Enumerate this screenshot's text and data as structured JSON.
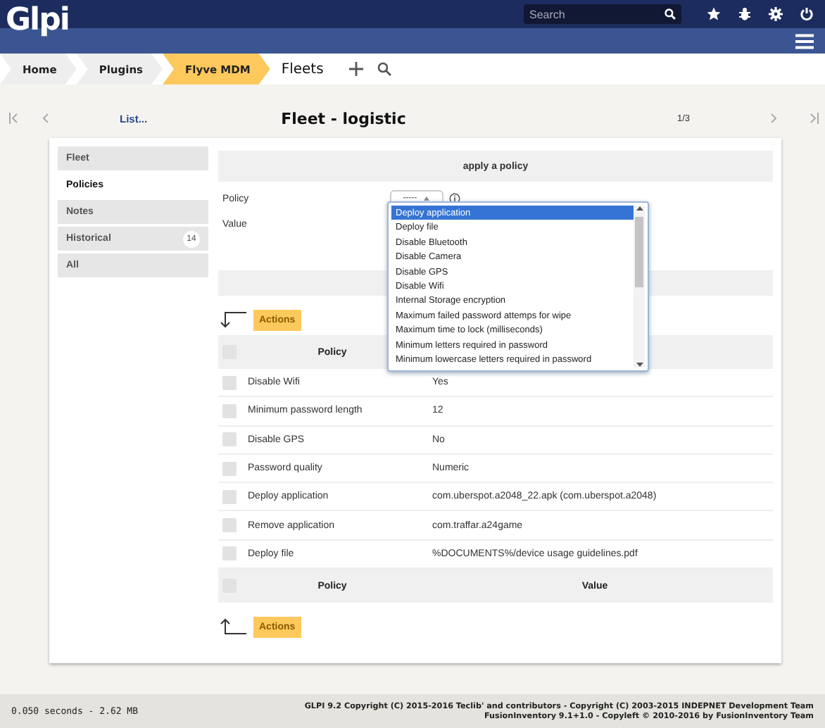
{
  "header": {
    "logo": "Glpi",
    "search": {
      "placeholder": "Search"
    }
  },
  "breadcrumb": [
    {
      "label": "Home",
      "selected": false
    },
    {
      "label": "Plugins",
      "selected": false
    },
    {
      "label": "Flyve MDM",
      "selected": true
    }
  ],
  "page_title": "Fleets",
  "nav": {
    "list_link": "List...",
    "title": "Fleet - logistic",
    "counter": "1/3"
  },
  "tabs": [
    {
      "label": "Fleet",
      "selected": false
    },
    {
      "label": "Policies",
      "selected": true
    },
    {
      "label": "Notes",
      "selected": false
    },
    {
      "label": "Historical",
      "selected": false,
      "count": "14"
    },
    {
      "label": "All",
      "selected": false
    }
  ],
  "form": {
    "title": "apply a policy",
    "policy_label": "Policy",
    "policy_value": "-----",
    "value_label": "Value",
    "dropdown": [
      {
        "label": "Deploy application",
        "selected": true
      },
      {
        "label": "Deploy file",
        "selected": false
      },
      {
        "label": "Disable Bluetooth",
        "selected": false
      },
      {
        "label": "Disable Camera",
        "selected": false
      },
      {
        "label": "Disable GPS",
        "selected": false
      },
      {
        "label": "Disable Wifi",
        "selected": false
      },
      {
        "label": "Internal Storage encryption",
        "selected": false
      },
      {
        "label": "Maximum failed password attemps for wipe",
        "selected": false
      },
      {
        "label": "Maximum time to lock (milliseconds)",
        "selected": false
      },
      {
        "label": "Minimum letters required in password",
        "selected": false
      },
      {
        "label": "Minimum lowercase letters required in password",
        "selected": false
      }
    ]
  },
  "actions_top": "Actions",
  "table": {
    "select_all": [
      {
        "checked": false
      },
      {
        "checked": false
      }
    ],
    "header_top": [
      "Policy"
    ],
    "header_bottom": [
      "Policy",
      "Value"
    ],
    "rows": [
      {
        "checked": false,
        "policy": "Disable Wifi",
        "value": "Yes"
      },
      {
        "checked": false,
        "policy": "Minimum password length",
        "value": "12"
      },
      {
        "checked": false,
        "policy": "Disable GPS",
        "value": "No"
      },
      {
        "checked": false,
        "policy": "Password quality",
        "value": "Numeric"
      },
      {
        "checked": false,
        "policy": "Deploy application",
        "value": "com.uberspot.a2048_22.apk (com.uberspot.a2048)"
      },
      {
        "checked": false,
        "policy": "Remove application",
        "value": "com.traffar.a24game"
      },
      {
        "checked": false,
        "policy": "Deploy file",
        "value": "%DOCUMENTS%/device usage guidelines.pdf"
      }
    ]
  },
  "actions_bottom": "Actions",
  "footer": {
    "timing": "0.050 seconds - 2.62 MB",
    "copyright": "GLPI 9.2 Copyright (C) 2015-2016 Teclib' and contributors - Copyright (C) 2003-2015 INDEPNET Development Team",
    "fusion": "FusionInventory 9.1+1.0 - Copyleft © 2010-2016 by FusionInventory Team"
  }
}
